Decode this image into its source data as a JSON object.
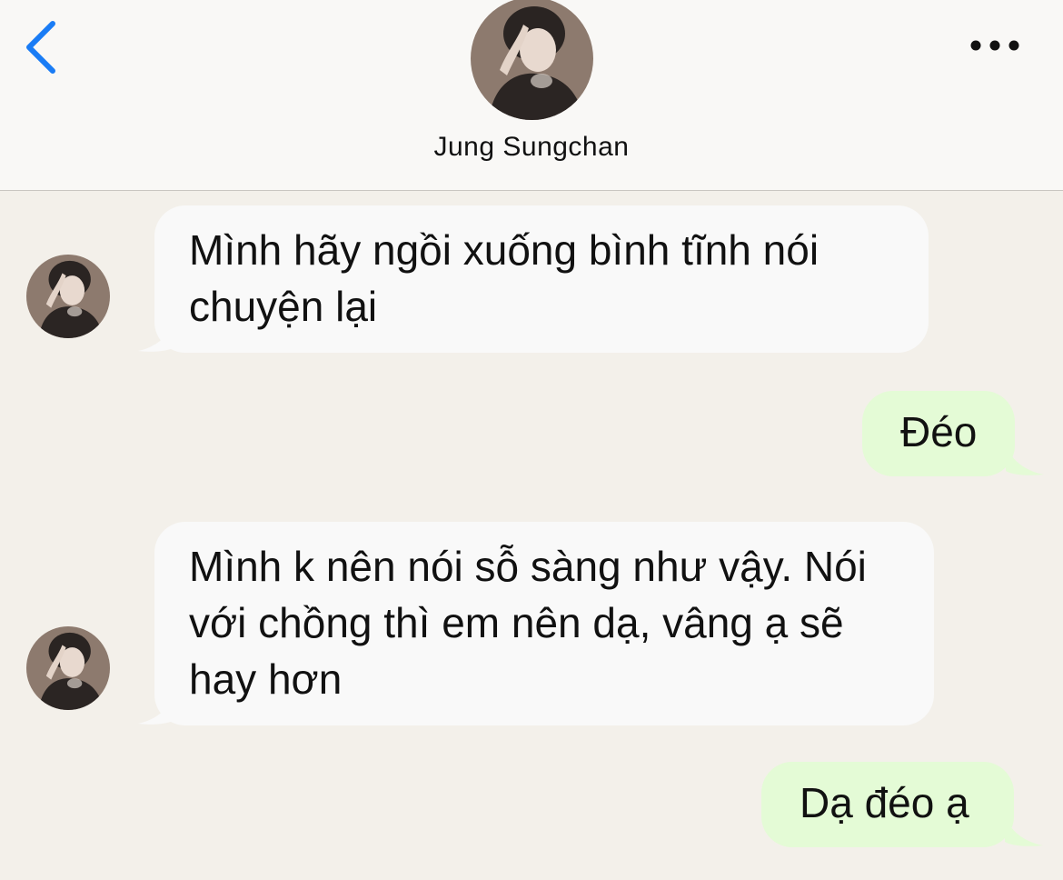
{
  "header": {
    "contact_name": "Jung Sungchan"
  },
  "colors": {
    "accent": "#1a7cf5",
    "incoming_bubble": "#f9f9f9",
    "outgoing_bubble": "#e4fbd6",
    "chat_background": "#f3f0ea"
  },
  "icons": {
    "back": "chevron-left-icon",
    "more": "more-dots-icon"
  },
  "messages": [
    {
      "direction": "incoming",
      "text": "Mình hãy ngồi xuống bình tĩnh nói chuyện lại"
    },
    {
      "direction": "outgoing",
      "text": "Đéo"
    },
    {
      "direction": "incoming",
      "text": "Mình k nên nói sỗ sàng như vậy. Nói với chồng thì em nên dạ, vâng ạ sẽ hay hơn"
    },
    {
      "direction": "outgoing",
      "text": "Dạ đéo ạ"
    }
  ]
}
